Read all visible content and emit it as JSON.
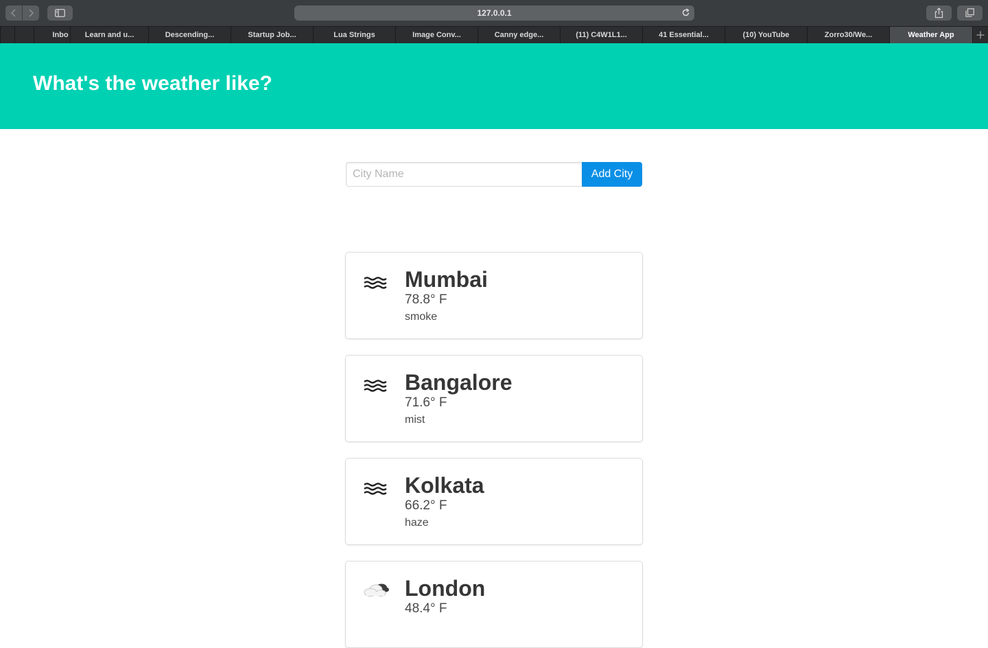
{
  "browser": {
    "address": "127.0.0.1",
    "tabs": [
      {
        "label": ""
      },
      {
        "label": ""
      },
      {
        "label": "Inbo"
      },
      {
        "label": "Learn and u..."
      },
      {
        "label": "Descending..."
      },
      {
        "label": "Startup Job..."
      },
      {
        "label": "Lua Strings"
      },
      {
        "label": "Image Conv..."
      },
      {
        "label": "Canny edge..."
      },
      {
        "label": "(11) C4W1L1..."
      },
      {
        "label": "41 Essential..."
      },
      {
        "label": "(10) YouTube"
      },
      {
        "label": "Zorro30/We..."
      },
      {
        "label": "Weather App"
      }
    ],
    "active_tab": "Weather App"
  },
  "hero": {
    "title": "What's the weather like?",
    "background_color": "#00d1b2"
  },
  "form": {
    "input_placeholder": "City Name",
    "input_value": "",
    "button_label": "Add City",
    "button_color": "#0a8fe6"
  },
  "cities": [
    {
      "name": "Mumbai",
      "temperature": "78.8° F",
      "description": "smoke",
      "icon": "mist-icon"
    },
    {
      "name": "Bangalore",
      "temperature": "71.6° F",
      "description": "mist",
      "icon": "mist-icon"
    },
    {
      "name": "Kolkata",
      "temperature": "66.2° F",
      "description": "haze",
      "icon": "mist-icon"
    },
    {
      "name": "London",
      "temperature": "48.4° F",
      "description": "",
      "icon": "cloudy-icon"
    }
  ]
}
